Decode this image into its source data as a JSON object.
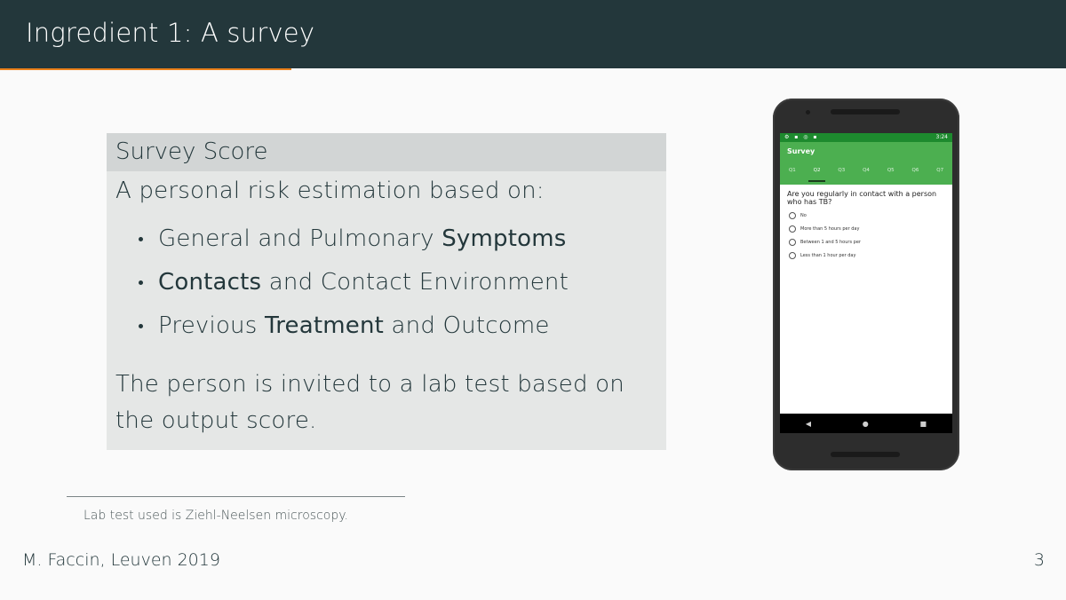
{
  "slide": {
    "title": "Ingredient 1: A survey",
    "page_number": "3",
    "footer": "M. Faccin, Leuven 2019",
    "footnote": "Lab test used is Ziehl-Neelsen microscopy."
  },
  "block": {
    "title": "Survey Score",
    "intro": "A personal risk estimation based on:",
    "bullets": [
      {
        "pre": "General and Pulmonary ",
        "strong": "Symptoms",
        "post": ""
      },
      {
        "pre": "",
        "strong": "Contacts",
        "post": " and Contact Environment"
      },
      {
        "pre": "Previous ",
        "strong": "Treatment",
        "post": " and Outcome"
      }
    ],
    "outro": "The person is invited to a lab test based on the output score."
  },
  "phone": {
    "status_time": "3:24",
    "app_title": "Survey",
    "tabs": [
      "Q1",
      "Q2",
      "Q3",
      "Q4",
      "Q5",
      "Q6",
      "Q7"
    ],
    "active_tab_index": 1,
    "question": "Are you regularly in contact with a person who has TB?",
    "options": [
      "No",
      "More than 5 hours per day",
      "Between 1 and 5 hours per",
      "Less than 1 hour per day"
    ],
    "nav": [
      "◀",
      "●",
      "■"
    ]
  },
  "colors": {
    "title_bar": "#23373b",
    "accent": "#eb811b",
    "app_green": "#4caf50"
  }
}
